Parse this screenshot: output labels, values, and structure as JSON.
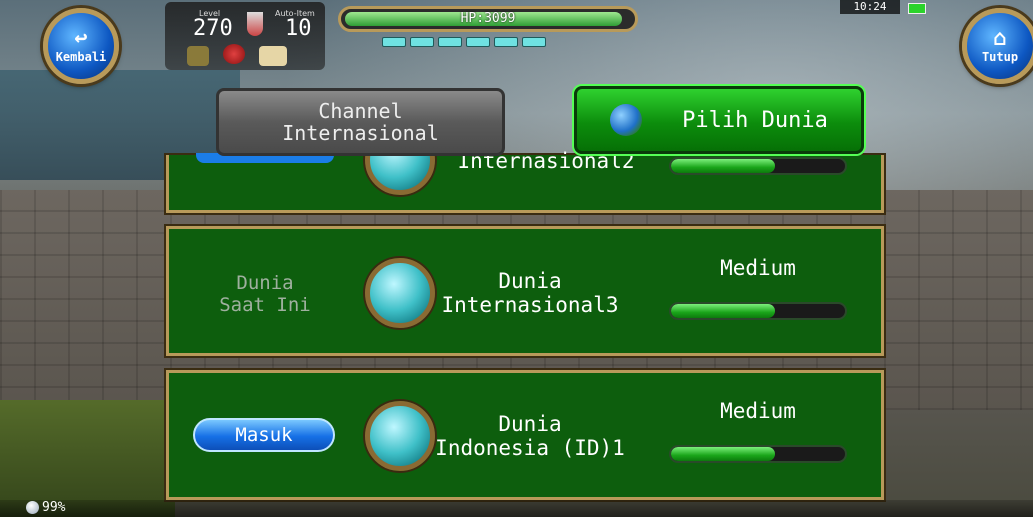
{
  "hud": {
    "back_label": "Kembali",
    "close_label": "Tutup",
    "level_label": "Level",
    "level_value": "270",
    "auto_item_label": "Auto-Item",
    "auto_item_value": "10",
    "hp_text": "HP:3099",
    "hp_fraction": 0.97,
    "mp_pips": 6,
    "time": "10:24"
  },
  "tabs": {
    "channel_label": "Channel\nInternasional",
    "world_label": "Pilih Dunia"
  },
  "servers": [
    {
      "name": "Internasional2",
      "load_fraction": 0.6
    },
    {
      "current_label": "Dunia\nSaat Ini",
      "name": "Dunia\nInternasional3",
      "load_label": "Medium",
      "load_fraction": 0.6
    },
    {
      "enter_label": "Masuk",
      "name": "Dunia\nIndonesia (ID)1",
      "load_label": "Medium",
      "load_fraction": 0.6
    }
  ],
  "footer": {
    "percent": "99%"
  },
  "colors": {
    "panel": "#0d5e0d",
    "tab_active": "#0c8d0c",
    "tab_inactive": "#5a5a5a",
    "enter_button": "#1670e6"
  }
}
